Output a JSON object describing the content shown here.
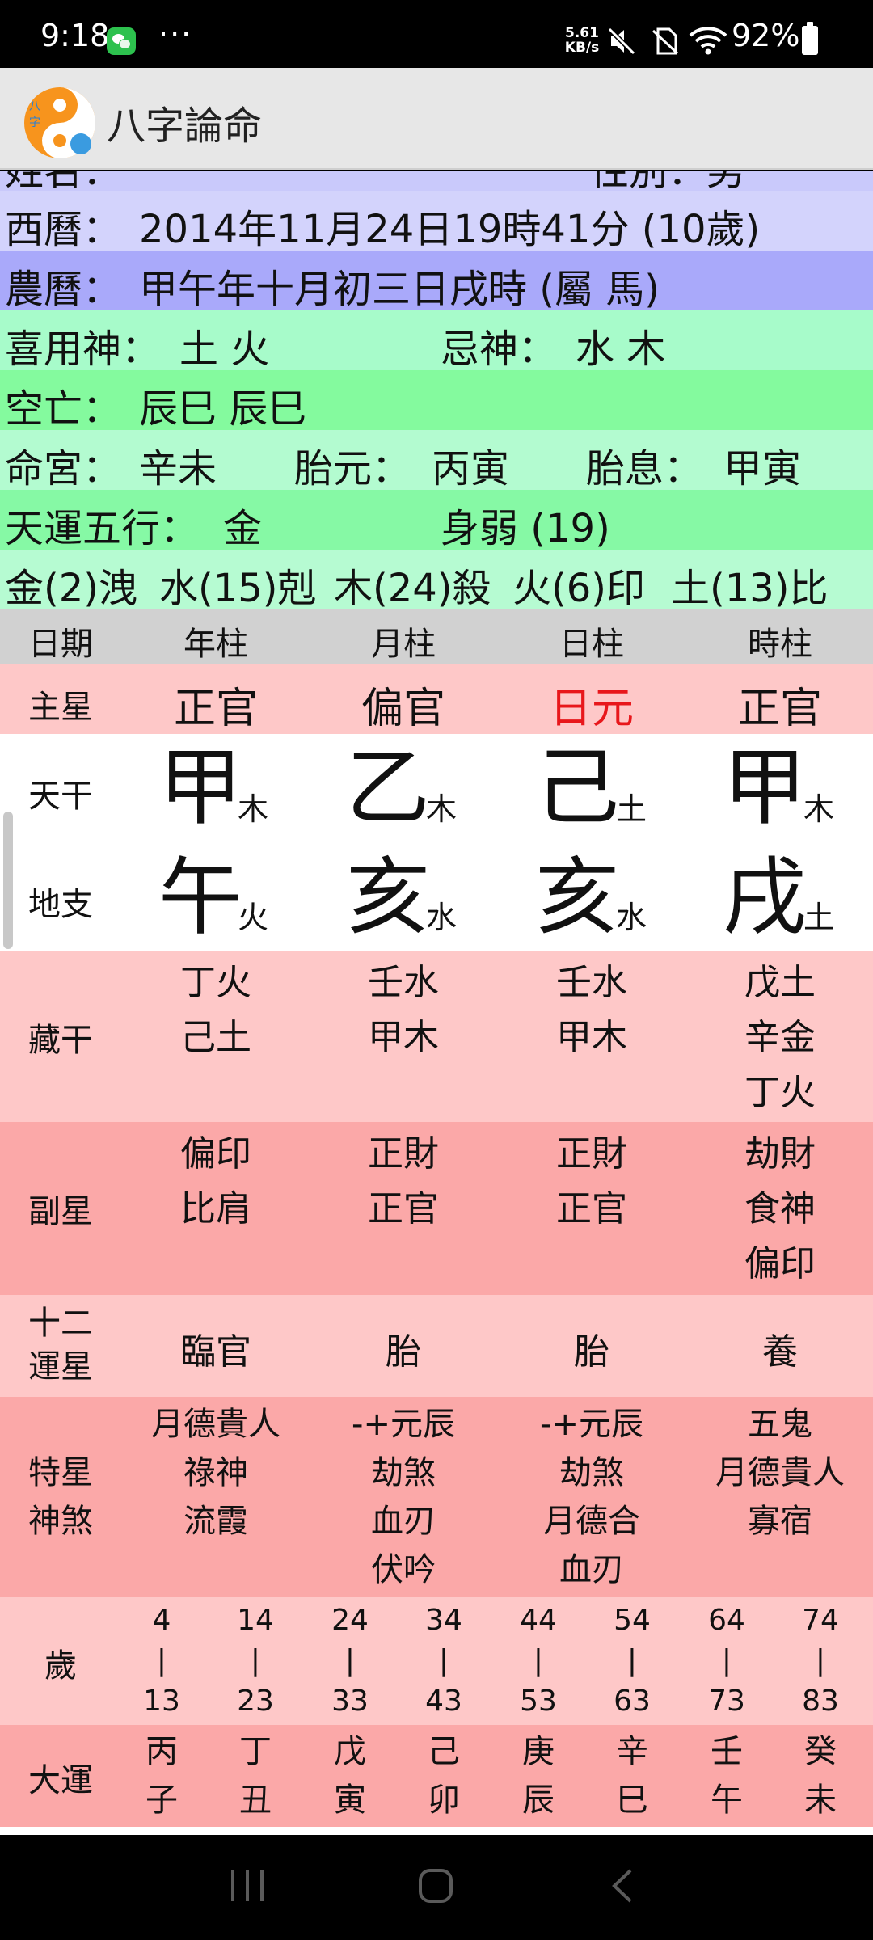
{
  "status_bar": {
    "time": "9:18",
    "dots": "···",
    "net_speed_top": "5.61",
    "net_speed_bottom": "KB/s",
    "battery": "92%"
  },
  "app_bar": {
    "title": "八字論命",
    "logo_text": "八字論命"
  },
  "info": {
    "partial_left": "姓名：",
    "partial_right": "性別：男",
    "solar_label": "西曆：",
    "solar_value": "2014年11月24日19時41分 (10歲)",
    "lunar_label": "農曆：",
    "lunar_value": "甲午年十月初三日戌時 (屬 馬)",
    "xiyong_label": "喜用神：",
    "xiyong_value": "土 火",
    "jishen_label": "忌神：",
    "jishen_value": "水 木",
    "kongwang_label": "空亡：",
    "kongwang_value": "辰巳 辰巳",
    "minggong_label": "命宮：",
    "minggong_value": "辛未",
    "taiyuan_label": "胎元：",
    "taiyuan_value": "丙寅",
    "taixi_label": "胎息：",
    "taixi_value": "甲寅",
    "tianyun_label": "天運五行：",
    "tianyun_value": "金",
    "shenruo": "身弱 (19)",
    "elements": [
      "金(2)洩",
      "水(15)剋",
      "木(24)殺",
      "火(6)印",
      "土(13)比"
    ]
  },
  "grid": {
    "header": [
      "日期",
      "年柱",
      "月柱",
      "日柱",
      "時柱"
    ],
    "main_star_label": "主星",
    "main_star": [
      "正官",
      "偏官",
      "日元",
      "正官"
    ],
    "heaven_label": "天干",
    "heaven": [
      {
        "char": "甲",
        "elem": "木"
      },
      {
        "char": "乙",
        "elem": "木"
      },
      {
        "char": "己",
        "elem": "土"
      },
      {
        "char": "甲",
        "elem": "木"
      }
    ],
    "earth_label": "地支",
    "earth": [
      {
        "char": "午",
        "elem": "火"
      },
      {
        "char": "亥",
        "elem": "水"
      },
      {
        "char": "亥",
        "elem": "水"
      },
      {
        "char": "戌",
        "elem": "土"
      }
    ],
    "canggan_label": "藏干",
    "canggan": [
      [
        "丁火",
        "己土"
      ],
      [
        "壬水",
        "甲木"
      ],
      [
        "壬水",
        "甲木"
      ],
      [
        "戊土",
        "辛金",
        "丁火"
      ]
    ],
    "fuxing_label": "副星",
    "fuxing": [
      [
        "偏印",
        "比肩"
      ],
      [
        "正財",
        "正官"
      ],
      [
        "正財",
        "正官"
      ],
      [
        "劫財",
        "食神",
        "偏印"
      ]
    ],
    "yunxing_label_1": "十二",
    "yunxing_label_2": "運星",
    "yunxing": [
      "臨官",
      "胎",
      "胎",
      "養"
    ],
    "shensha_label_1": "特星",
    "shensha_label_2": "神煞",
    "shensha": [
      [
        "月德貴人",
        "祿神",
        "流霞"
      ],
      [
        "-+元辰",
        "劫煞",
        "血刃",
        "伏吟"
      ],
      [
        "-+元辰",
        "劫煞",
        "月德合",
        "血刃"
      ],
      [
        "五鬼",
        "月德貴人",
        "寡宿"
      ]
    ],
    "age_label": "歲",
    "age_start": [
      "4",
      "14",
      "24",
      "34",
      "44",
      "54",
      "64",
      "74"
    ],
    "age_sep": "|",
    "age_end": [
      "13",
      "23",
      "33",
      "43",
      "53",
      "63",
      "73",
      "83"
    ],
    "dayun_label": "大運",
    "dayun_top": [
      "丙",
      "丁",
      "戊",
      "己",
      "庚",
      "辛",
      "壬",
      "癸"
    ],
    "dayun_bottom": [
      "子",
      "丑",
      "寅",
      "卯",
      "辰",
      "巳",
      "午",
      "未"
    ]
  },
  "colors": {
    "day_master": "#e8171b",
    "status_bg": "#000000",
    "appbar_bg": "#e7e7e7"
  }
}
